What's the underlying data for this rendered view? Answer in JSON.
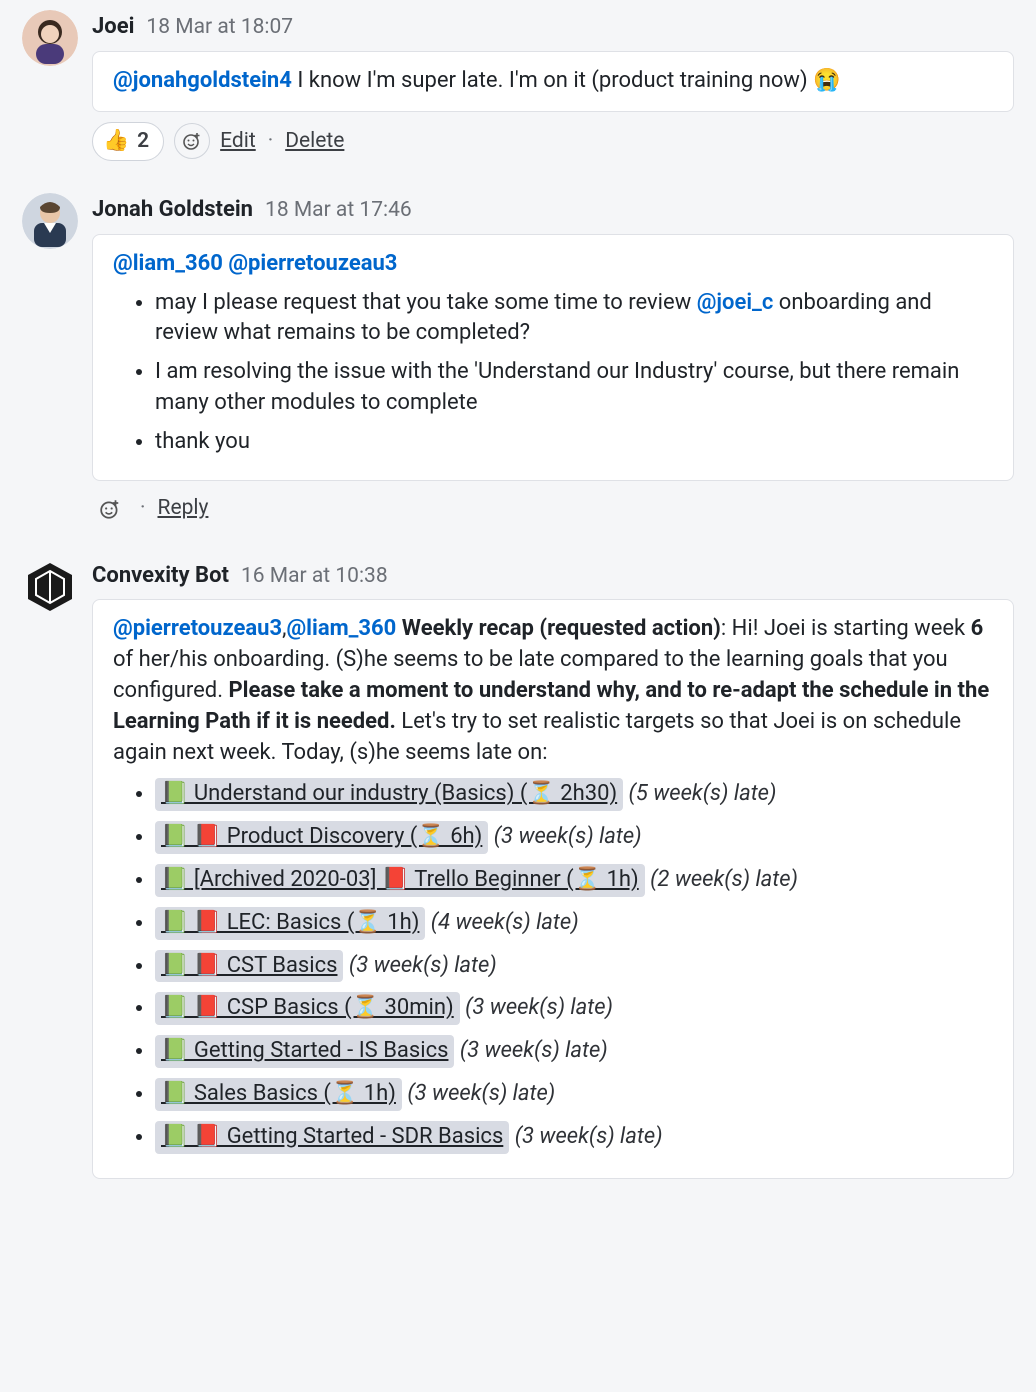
{
  "posts": [
    {
      "author": "Joei",
      "timestamp": "18 Mar at 18:07",
      "mention": "@jonahgoldstein4",
      "text": " I know I'm super late. I'm on it (product training now) 😭",
      "reaction_emoji": "👍",
      "reaction_count": "2",
      "edit": "Edit",
      "delete": "Delete"
    },
    {
      "author": "Jonah Goldstein",
      "timestamp": "18 Mar at 17:46",
      "mention1": "@liam_360",
      "mention2": "@pierretouzeau3",
      "bullet1a": "may I please request that you take some time to review ",
      "bullet1_mention": "@joei_c",
      "bullet1b": " onboarding and review what remains to be completed?",
      "bullet2": "I am resolving the issue with the 'Understand our Industry' course, but there remain many other modules to complete",
      "bullet3": "thank you",
      "reply": "Reply"
    },
    {
      "author": "Convexity Bot",
      "timestamp": "16 Mar at 10:38",
      "mention1": "@pierretouzeau3",
      "mention2": "@liam_360",
      "bold_recap": "Weekly recap (requested action)",
      "intro_a": ": Hi! Joei is starting week ",
      "week": "6",
      "intro_b": " of her/his onboarding. (S)he seems to be late compared to the learning goals that you configured. ",
      "bold_please": "Please take a moment to understand why, and to re-adapt the schedule in the Learning Path if it is needed.",
      "intro_c": " Let's try to set realistic targets so that Joei is on schedule again next week. Today, (s)he seems late on:",
      "courses": [
        {
          "prefix": "📗 ",
          "title": "Understand our industry (Basics)  (⏳ 2h30)",
          "late": "(5 week(s) late)"
        },
        {
          "prefix": "📗 📕  ",
          "title": "Product Discovery (⏳ 6h)",
          "late": "(3 week(s) late)"
        },
        {
          "prefix": "📗 ",
          "title": "[Archived 2020-03] 📕  Trello Beginner (⏳ 1h)",
          "late": "(2 week(s) late)"
        },
        {
          "prefix": "📗 📕  ",
          "title": "LEC: Basics (⏳ 1h)",
          "late": "(4 week(s) late)"
        },
        {
          "prefix": "📗 📕  ",
          "title": "CST Basics",
          "late": "(3 week(s) late)"
        },
        {
          "prefix": "📗 📕  ",
          "title": "CSP Basics (⏳ 30min)",
          "late": "(3 week(s) late)"
        },
        {
          "prefix": "📗 ",
          "title": "Getting Started - IS Basics",
          "late": "(3 week(s) late)"
        },
        {
          "prefix": "📗 ",
          "title": "Sales Basics (⏳ 1h)",
          "late": "(3 week(s) late)"
        },
        {
          "prefix": "📗 📕  ",
          "title": "Getting Started - SDR Basics",
          "late": "(3 week(s) late)"
        }
      ]
    }
  ]
}
